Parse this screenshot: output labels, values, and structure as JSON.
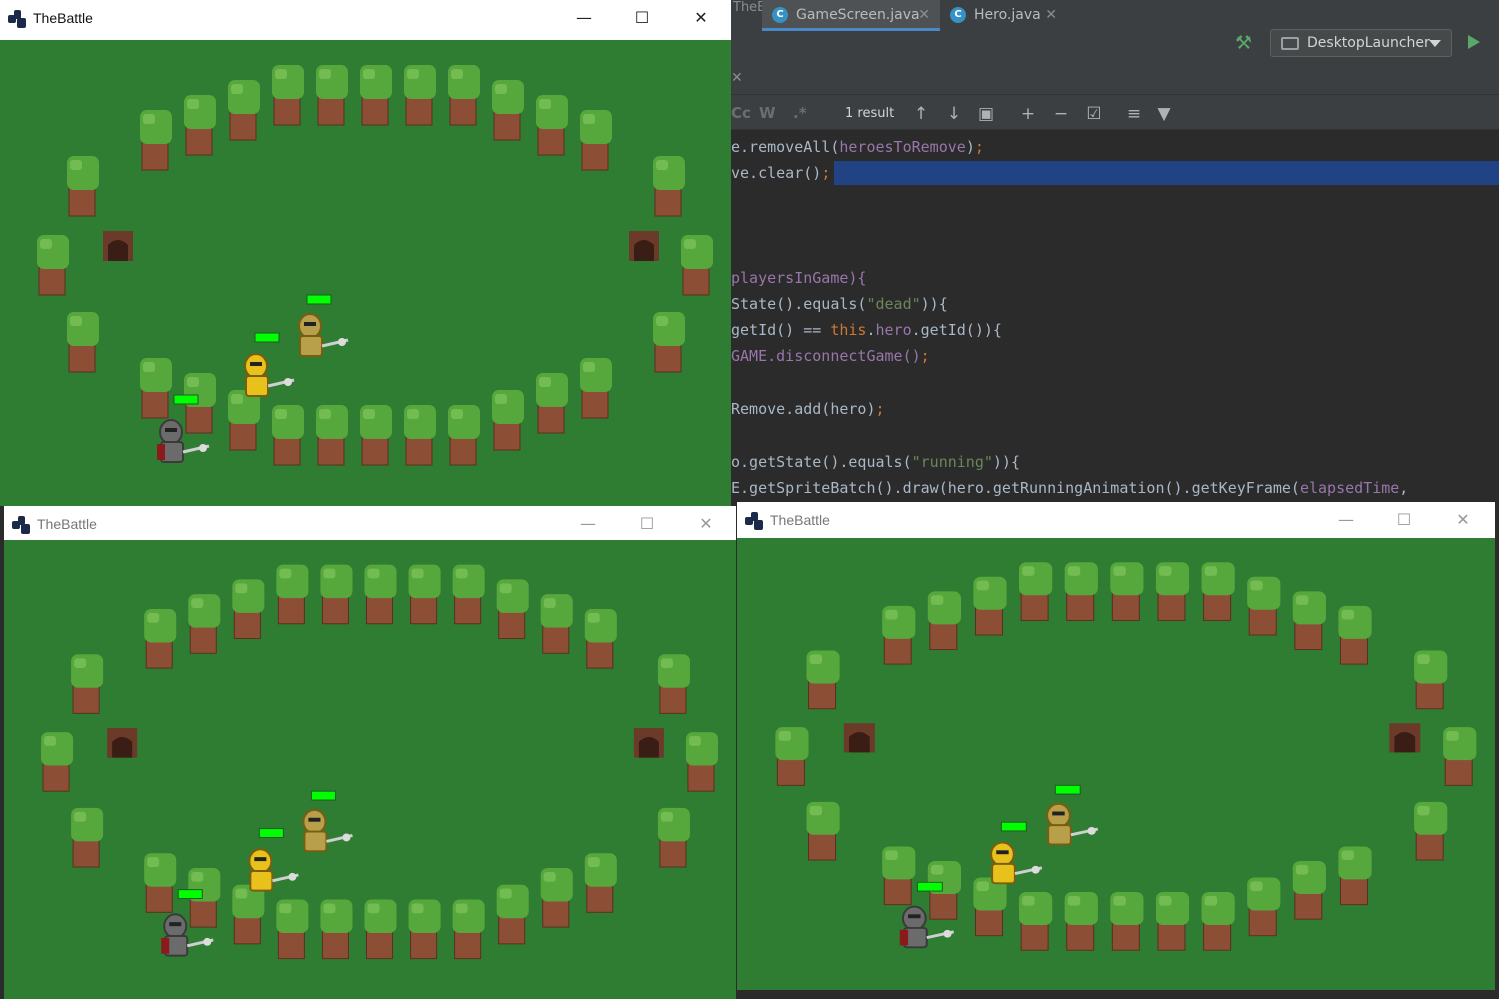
{
  "ide": {
    "title_fragment": "TheBattle.core.main]",
    "run_config": "DesktopLauncher",
    "tabs": [
      {
        "label": "GameScreen.java",
        "active": true
      },
      {
        "label": "Hero.java",
        "active": false
      }
    ],
    "find": {
      "opt_cc": "Cc",
      "opt_w": "W",
      "opt_regex": ".*",
      "result": "1 result"
    },
    "code_lines": [
      {
        "text": "e.removeAll(heroesToRemove);"
      },
      {
        "text": "ve.clear();"
      },
      {
        "text": "playersInGame){"
      },
      {
        "text": "State().equals(\"dead\")){"
      },
      {
        "text": "getId() == this.hero.getId()){"
      },
      {
        "text": "GAME.disconnectGame();"
      },
      {
        "text": "Remove.add(hero);"
      },
      {
        "text": "o.getState().equals(\"running\")){"
      },
      {
        "text": "E.getSpriteBatch().draw(hero.getRunningAnimation().getKeyFrame(elapsedTime,"
      }
    ]
  },
  "windows": [
    {
      "title": "TheBattle",
      "active": true
    },
    {
      "title": "TheBattle",
      "active": false
    },
    {
      "title": "TheBattle",
      "active": false
    }
  ],
  "game": {
    "colors": {
      "grass": "#2e7d32",
      "trunk": "#8d4e36",
      "leaves": "#57a83c",
      "health": "#00ff00",
      "cave": "#3a1d14"
    },
    "heroes": [
      {
        "name": "gold-knight",
        "health": 1.0
      },
      {
        "name": "yellow-winged-knight",
        "health": 1.0
      },
      {
        "name": "dark-knight",
        "health": 1.0
      }
    ]
  }
}
